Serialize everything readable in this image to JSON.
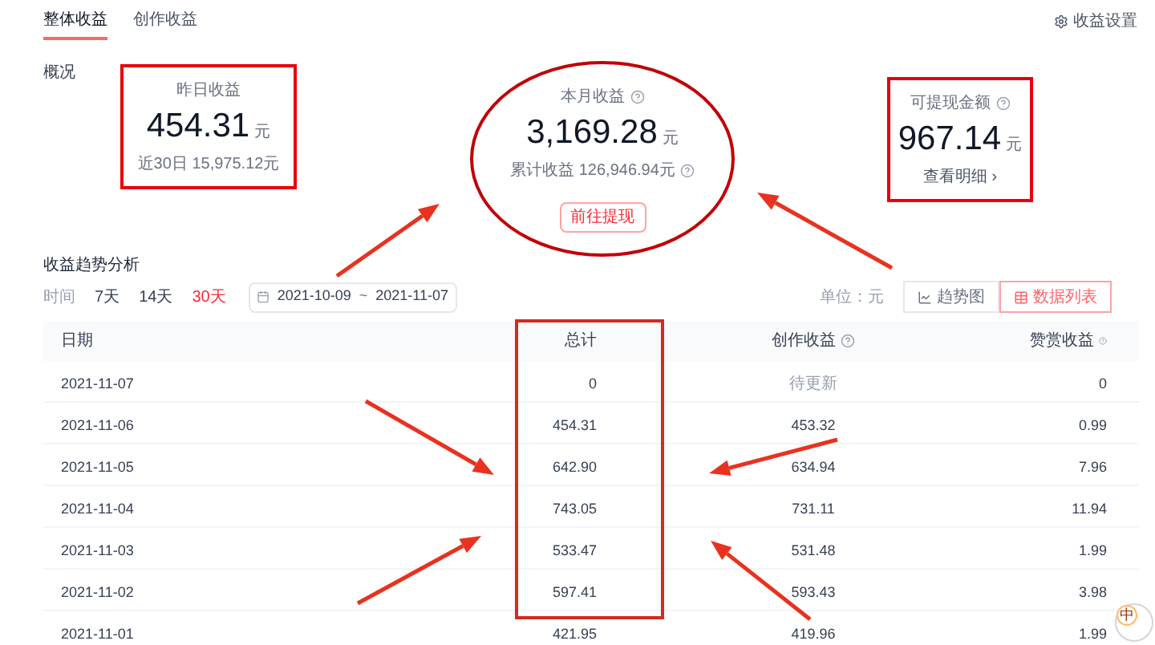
{
  "tabs": [
    {
      "label": "整体收益",
      "selected": true
    },
    {
      "label": "创作收益",
      "selected": false
    }
  ],
  "settings_link": "收益设置",
  "overview": {
    "label": "概况",
    "cards": [
      {
        "kind": "box",
        "title": "昨日收益",
        "help": false,
        "value": "454.31",
        "unit": "元",
        "sub": "近30日 15,975.12元",
        "sub_help": false
      },
      {
        "kind": "ellipse",
        "title": "本月收益",
        "help": true,
        "value": "3,169.28",
        "unit": "元",
        "sub": "累计收益 126,946.94元",
        "sub_help": true,
        "button": "前往提现"
      },
      {
        "kind": "box",
        "title": "可提现金额",
        "help": true,
        "value": "967.14",
        "unit": "元",
        "link": "查看明细 ›"
      }
    ]
  },
  "trend": {
    "title": "收益趋势分析",
    "time_label": "时间",
    "ranges": [
      {
        "label": "7天",
        "selected": false
      },
      {
        "label": "14天",
        "selected": false
      },
      {
        "label": "30天",
        "selected": true
      }
    ],
    "date_start": "2021-10-09",
    "date_sep": "~",
    "date_end": "2021-11-07",
    "unit": "单位：元",
    "views": [
      {
        "label": "趋势图",
        "kind": "chart",
        "selected": false
      },
      {
        "label": "数据列表",
        "kind": "list",
        "selected": true
      }
    ]
  },
  "table": {
    "columns": [
      {
        "label": "日期",
        "help": false
      },
      {
        "label": "总计",
        "help": false
      },
      {
        "label": "创作收益",
        "help": true
      },
      {
        "label": "赞赏收益",
        "help": true
      }
    ],
    "rows": [
      {
        "date": "2021-11-07",
        "total": "0",
        "creation": "待更新",
        "creation_pending": true,
        "tips": "0"
      },
      {
        "date": "2021-11-06",
        "total": "454.31",
        "creation": "453.32",
        "creation_pending": false,
        "tips": "0.99"
      },
      {
        "date": "2021-11-05",
        "total": "642.90",
        "creation": "634.94",
        "creation_pending": false,
        "tips": "7.96"
      },
      {
        "date": "2021-11-04",
        "total": "743.05",
        "creation": "731.11",
        "creation_pending": false,
        "tips": "11.94"
      },
      {
        "date": "2021-11-03",
        "total": "533.47",
        "creation": "531.48",
        "creation_pending": false,
        "tips": "1.99"
      },
      {
        "date": "2021-11-02",
        "total": "597.41",
        "creation": "593.43",
        "creation_pending": false,
        "tips": "3.98"
      },
      {
        "date": "2021-11-01",
        "total": "421.95",
        "creation": "419.96",
        "creation_pending": false,
        "tips": "1.99"
      }
    ]
  },
  "ime_widget": {
    "mode": "中"
  }
}
